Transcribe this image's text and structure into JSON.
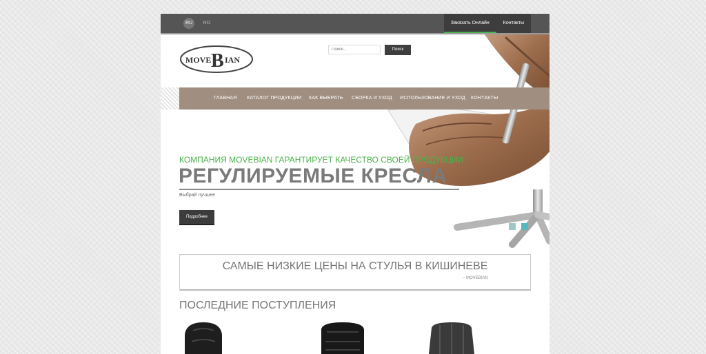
{
  "topbar": {
    "languages": [
      {
        "code": "RU",
        "active": true
      },
      {
        "code": "RO",
        "active": false
      }
    ],
    "links": [
      "Заказать Онлайн",
      "Контакты"
    ],
    "accent_color": "#4caf50"
  },
  "header": {
    "logo_text": "MOVEBIAN",
    "logo_part_left": "MOVE",
    "logo_part_big": "B",
    "logo_part_right": "IAN",
    "search_placeholder": "Поиск...",
    "search_button": "Поиск"
  },
  "nav": {
    "items": [
      "ГЛАВНАЯ",
      "КАТАЛОГ ПРОДУКЦИИ",
      "КАК ВЫБРАТЬ",
      "СБОРКА И УХОД",
      "ИСПОЛЬЗОВАНИЕ И УХОД",
      "КОНТАКТЫ"
    ],
    "background": "#a08e80"
  },
  "hero": {
    "tagline": "КОМПАНИЯ MOVEBIAN ГАРАНТИРУЕТ КАЧЕСТВО СВОЕЙ ПРОДУКЦИИ",
    "title": "РЕГУЛИРУЕМЫЕ КРЕСЛА",
    "subtitle": "Выбрай лучшее",
    "button": "Подробнее",
    "slides": 2,
    "active_slide": 2
  },
  "quote": {
    "text": "САМЫЕ НИЗКИЕ ЦЕНЫ НА СТУЛЬЯ В КИШИНЕВЕ",
    "author": "– MOVEBIAN"
  },
  "latest": {
    "heading": "ПОСЛЕДНИЕ ПОСТУПЛЕНИЯ"
  }
}
